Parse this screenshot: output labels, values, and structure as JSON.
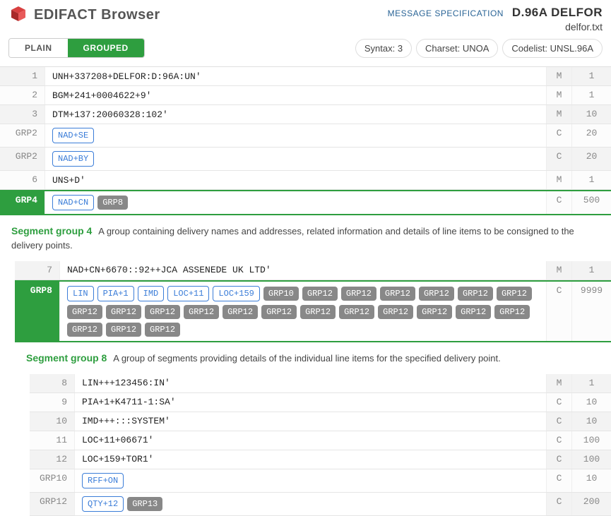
{
  "header": {
    "brand": "EDIFACT Browser",
    "spec_link": "MESSAGE SPECIFICATION",
    "spec_version": "D.96A DELFOR",
    "spec_file": "delfor.txt"
  },
  "toolbar": {
    "tabs": {
      "plain": "PLAIN",
      "grouped": "GROUPED"
    },
    "pills": {
      "syntax_label": "Syntax:",
      "syntax_val": "3",
      "charset_label": "Charset:",
      "charset_val": "UNOA",
      "codelist_label": "Codelist:",
      "codelist_val": "UNSL.96A"
    }
  },
  "rows_top": [
    {
      "n": "1",
      "text": "UNH+337208+DELFOR:D:96A:UN'",
      "mc": "M",
      "rep": "1"
    },
    {
      "n": "2",
      "text": "BGM+241+0004622+9'",
      "mc": "M",
      "rep": "1"
    },
    {
      "n": "3",
      "text": "DTM+137:20060328:102'",
      "mc": "M",
      "rep": "10"
    }
  ],
  "grp2": [
    {
      "n": "GRP2",
      "tag": "NAD+SE",
      "mc": "C",
      "rep": "20"
    },
    {
      "n": "GRP2",
      "tag": "NAD+BY",
      "mc": "C",
      "rep": "20"
    }
  ],
  "row6": {
    "n": "6",
    "text": "UNS+D'",
    "mc": "M",
    "rep": "1"
  },
  "grp4": {
    "n": "GRP4",
    "tag1": "NAD+CN",
    "tag2": "GRP8",
    "mc": "C",
    "rep": "500",
    "desc_title": "Segment group 4",
    "desc_text": "A group containing delivery names and addresses, related information and details of line items to be consigned to the delivery points."
  },
  "row7": {
    "n": "7",
    "text": "NAD+CN+6670::92++JCA ASSENEDE UK LTD'",
    "mc": "M",
    "rep": "1"
  },
  "grp8": {
    "n": "GRP8",
    "blue_tags": [
      "LIN",
      "PIA+1",
      "IMD",
      "LOC+11",
      "LOC+159"
    ],
    "grey_tags": [
      "GRP10",
      "GRP12",
      "GRP12",
      "GRP12",
      "GRP12",
      "GRP12",
      "GRP12",
      "GRP12",
      "GRP12",
      "GRP12",
      "GRP12",
      "GRP12",
      "GRP12",
      "GRP12",
      "GRP12",
      "GRP12",
      "GRP12",
      "GRP12",
      "GRP12",
      "GRP12",
      "GRP12",
      "GRP12"
    ],
    "mc": "C",
    "rep": "9999",
    "desc_title": "Segment group 8",
    "desc_text": "A group of segments providing details of the individual line items for the specified delivery point."
  },
  "rows_inner": [
    {
      "n": "8",
      "text": "LIN+++123456:IN'",
      "mc": "M",
      "rep": "1"
    },
    {
      "n": "9",
      "text": "PIA+1+K4711-1:SA'",
      "mc": "C",
      "rep": "10"
    },
    {
      "n": "10",
      "text": "IMD+++:::SYSTEM'",
      "mc": "C",
      "rep": "10"
    },
    {
      "n": "11",
      "text": "LOC+11+06671'",
      "mc": "C",
      "rep": "100"
    },
    {
      "n": "12",
      "text": "LOC+159+TOR1'",
      "mc": "C",
      "rep": "100"
    }
  ],
  "grp10": {
    "n": "GRP10",
    "tag": "RFF+ON",
    "mc": "C",
    "rep": "10"
  },
  "grp12": {
    "n": "GRP12",
    "tag1": "QTY+12",
    "tag2": "GRP13",
    "mc": "C",
    "rep": "200"
  }
}
